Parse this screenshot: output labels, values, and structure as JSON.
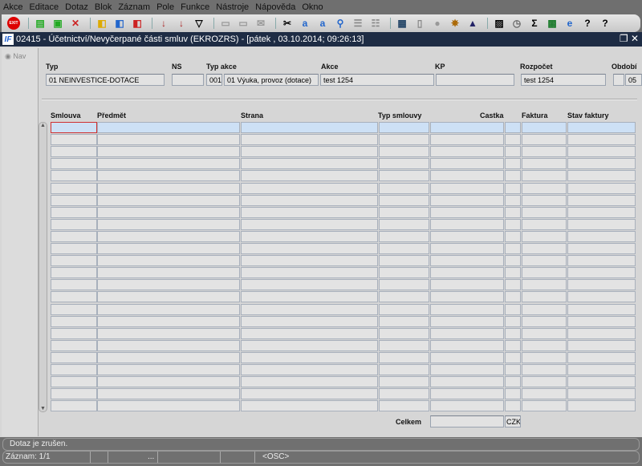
{
  "menu": [
    "Akce",
    "Editace",
    "Dotaz",
    "Blok",
    "Záznam",
    "Pole",
    "Funkce",
    "Nástroje",
    "Nápověda",
    "Okno"
  ],
  "toolbar": {
    "exit_label": "EXIT"
  },
  "window": {
    "title": "02415 - Účetnictví/Nevyčerpané části smluv (EKROZRS) - [pátek  , 03.10.2014; 09:26:13]",
    "logo": "IF"
  },
  "nav": {
    "label": "Nav"
  },
  "header": {
    "typ_label": "Typ",
    "typ_value": "01 NEINVESTICE-DOTACE",
    "ns_label": "NS",
    "ns_value": "",
    "typ_akce_label": "Typ akce",
    "typ_akce_code": "001",
    "typ_akce_value": "01 Výuka, provoz (dotace)",
    "akce_label": "Akce",
    "akce_value": "test 1254",
    "kp_label": "KP",
    "kp_value": "",
    "rozpocet_label": "Rozpočet",
    "rozpocet_value": "test 1254",
    "obdobi_label": "Období",
    "obdobi_value": "05"
  },
  "table": {
    "columns": [
      "Smlouva",
      "Předmět",
      "Strana",
      "Typ smlouvy",
      "Castka",
      "",
      "Faktura",
      "Stav faktury"
    ],
    "row_count": 24
  },
  "footer": {
    "total_label": "Celkem",
    "total_value": "",
    "currency": "CZK"
  },
  "status": {
    "message": "Dotaz je zrušen.",
    "record": "Záznam: 1/1",
    "ellipsis": "...",
    "mode": "<OSC>"
  }
}
